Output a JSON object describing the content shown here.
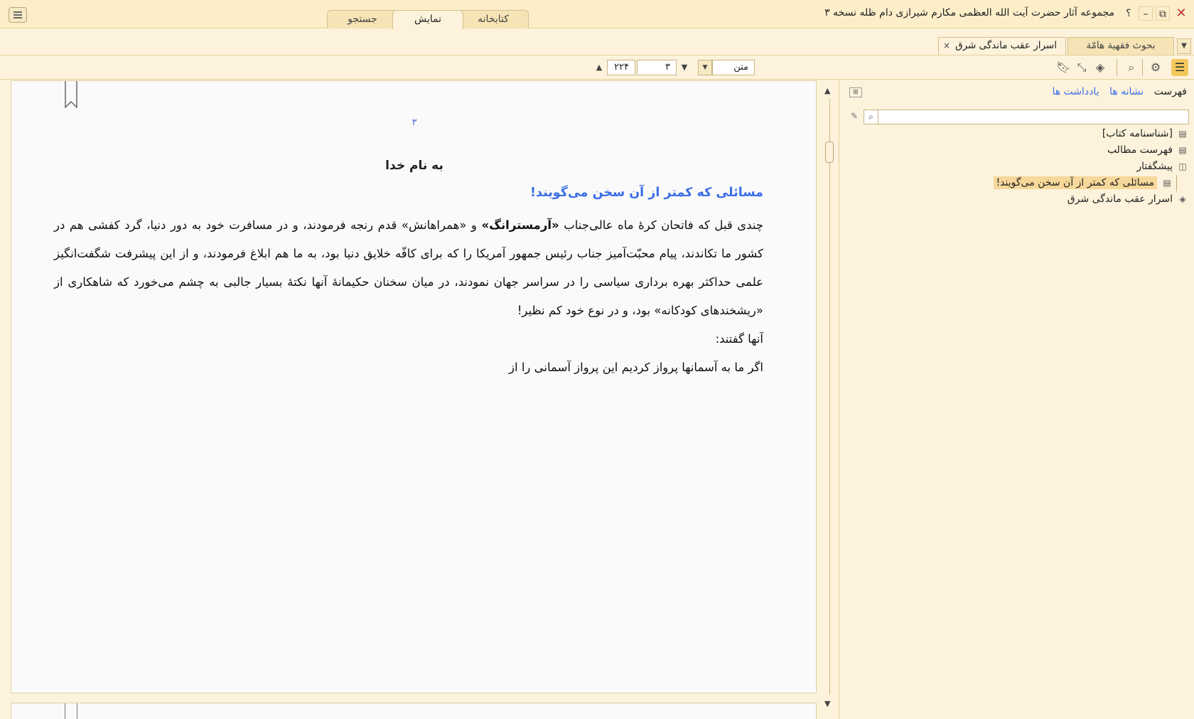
{
  "window": {
    "title": "مجموعه آثار حضرت آیت الله العظمی مکارم شیرازی دام ظله نسخه ۳",
    "help_label": "؟",
    "minimize_label": "–",
    "restore_label": "⧉",
    "close_label": "✕"
  },
  "main_tabs": [
    {
      "label": "کتابخانه"
    },
    {
      "label": "نمایش"
    },
    {
      "label": "جستجو"
    }
  ],
  "doc_tabs": [
    {
      "label": "بحوث فقهیة هامّة"
    },
    {
      "label": "اسرار عقب ماندگی شرق",
      "close": "×"
    }
  ],
  "doc_tabs_dropdown": "▼",
  "toolbar": {
    "view_mode": "متن",
    "page_current": "۳",
    "page_total": "۲۲۴",
    "down_arrow": "▼",
    "next_arrow": "🡇",
    "prev_arrow": "🡅",
    "icons": [
      "list-icon",
      "gear-icon",
      "search-icon",
      "eraser-icon",
      "fullscreen-icon",
      "bookmark-icon"
    ]
  },
  "reader": {
    "page_number": "۳",
    "basmala": "به نام خدا",
    "heading": "مسائلی که کمتر از آن سخن می‌گویند!",
    "para1_a": "چندی قبل که فاتحان کرۀ ماه عالی‌جناب ",
    "para1_bold": "«آرمسترانگ»",
    "para1_b": " و «همراهانش» قدم رنجه فرمودند، و در مسافرت خود به دور دنیا، گرد کفشی هم در کشور ما تکاندند، پیام محبّت‌آمیز جناب رئیس جمهور آمریکا را که برای کافّه خلایق دنیا بود، به ما هم ابلاغ فرمودند، و از این پیشرفت شگفت‌انگیز علمی حداکثر بهره برداری سیاسی را در سراسر جهان نمودند، در میان سخنان حکیمانۀ آنها نکتۀ بسیار جالبی به چشم می‌خورد که شاهکاری از «ریشخندهای کودکانه» بود، و در نوع خود کم نظیر!",
    "para2": "آنها گفتند:",
    "para3": "اگر ما به آسمانها پرواز کردیم این پرواز آسمانی را از"
  },
  "panel": {
    "tab_toc": "فهرست",
    "tab_bookmarks": "نشانه ها",
    "tab_notes": "یادداشت ها",
    "search_placeholder": "",
    "search_icon": "⌕",
    "tree": [
      {
        "label": "[شناسنامه کتاب]",
        "icon": "document-icon"
      },
      {
        "label": "فهرست مطالب",
        "icon": "document-icon"
      },
      {
        "label": "پیشگفتار",
        "icon": "open-book-icon"
      },
      {
        "label": "مسائلی که کمتر از آن سخن می‌گویند!",
        "icon": "document-icon",
        "selected": true
      },
      {
        "label": "اسرار عقب ماندگی شرق",
        "icon": "book-icon"
      }
    ]
  },
  "colors": {
    "background": "#fdf3dc",
    "accent_link": "#3b6ee8",
    "selection": "#f6d89a",
    "active_icon": "#f4c95d",
    "close": "#b33333"
  }
}
